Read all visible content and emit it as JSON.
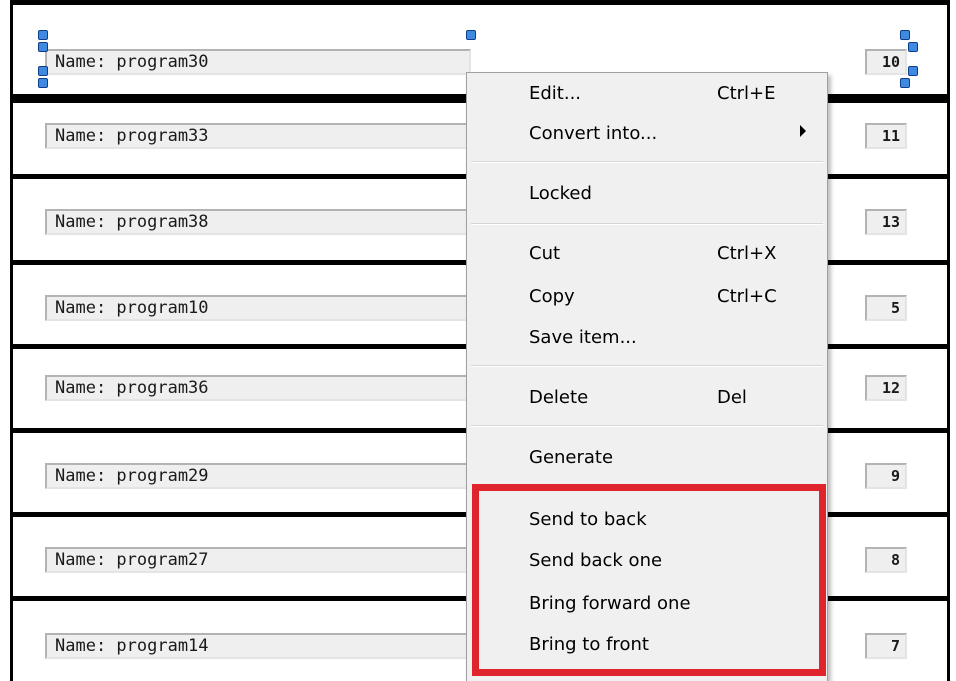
{
  "rows": [
    {
      "name": "Name: program30",
      "number": "10",
      "selected": true
    },
    {
      "name": "Name: program33",
      "number": "11"
    },
    {
      "name": "Name: program38",
      "number": "13"
    },
    {
      "name": "Name: program10",
      "number": "5"
    },
    {
      "name": "Name: program36",
      "number": "12"
    },
    {
      "name": "Name: program29",
      "number": "9"
    },
    {
      "name": "Name: program27",
      "number": "8"
    },
    {
      "name": "Name: program14",
      "number": "7"
    }
  ],
  "context_menu": {
    "items": [
      {
        "label": "Edit...",
        "shortcut": "Ctrl+E"
      },
      {
        "label": "Convert into...",
        "submenu": true
      },
      {
        "label": "Locked"
      },
      {
        "label": "Cut",
        "shortcut": "Ctrl+X"
      },
      {
        "label": "Copy",
        "shortcut": "Ctrl+C"
      },
      {
        "label": "Save item..."
      },
      {
        "label": "Delete",
        "shortcut": "Del"
      },
      {
        "label": "Generate"
      },
      {
        "label": "Send to back"
      },
      {
        "label": "Send back one"
      },
      {
        "label": "Bring forward one"
      },
      {
        "label": "Bring to front"
      }
    ]
  },
  "colors": {
    "highlight": "#e0242c",
    "selection_handle": "#3f89e0"
  }
}
